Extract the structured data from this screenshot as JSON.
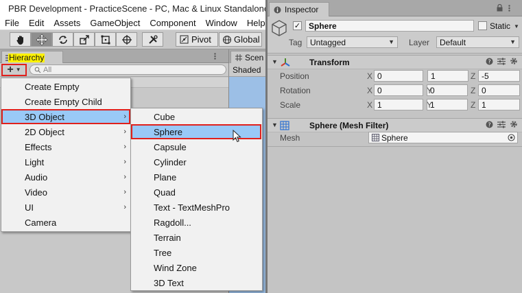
{
  "window": {
    "title": "PBR Development - PracticeScene - PC, Mac & Linux Standalone -"
  },
  "menu_bar": [
    "File",
    "Edit",
    "Assets",
    "GameObject",
    "Component",
    "Window",
    "Help"
  ],
  "toolbar": {
    "pivot_label": "Pivot",
    "global_label": "Global"
  },
  "hierarchy": {
    "tab_label": "Hierarchy",
    "search_placeholder": "All"
  },
  "scene": {
    "tab_label": "Scen",
    "shading_mode": "Shaded"
  },
  "create_menu": {
    "items": [
      {
        "label": "Create Empty",
        "has_submenu": false
      },
      {
        "label": "Create Empty Child",
        "has_submenu": false
      },
      {
        "label": "3D Object",
        "has_submenu": true,
        "highlighted": true
      },
      {
        "label": "2D Object",
        "has_submenu": true
      },
      {
        "label": "Effects",
        "has_submenu": true
      },
      {
        "label": "Light",
        "has_submenu": true
      },
      {
        "label": "Audio",
        "has_submenu": true
      },
      {
        "label": "Video",
        "has_submenu": true
      },
      {
        "label": "UI",
        "has_submenu": true
      },
      {
        "label": "Camera",
        "has_submenu": false
      }
    ]
  },
  "submenu_3d_object": {
    "items": [
      {
        "label": "Cube"
      },
      {
        "label": "Sphere",
        "highlighted": true
      },
      {
        "label": "Capsule"
      },
      {
        "label": "Cylinder"
      },
      {
        "label": "Plane"
      },
      {
        "label": "Quad"
      },
      {
        "label": "Text - TextMeshPro"
      },
      {
        "label": "Ragdoll..."
      },
      {
        "label": "Terrain"
      },
      {
        "label": "Tree"
      },
      {
        "label": "Wind Zone"
      },
      {
        "label": "3D Text"
      }
    ]
  },
  "inspector": {
    "tab_label": "Inspector",
    "object_name": "Sphere",
    "static_label": "Static",
    "tag_label": "Tag",
    "tag_value": "Untagged",
    "layer_label": "Layer",
    "layer_value": "Default",
    "transform": {
      "title": "Transform",
      "position": {
        "label": "Position",
        "x": "0",
        "y": "1",
        "z": "-5"
      },
      "rotation": {
        "label": "Rotation",
        "x": "0",
        "y": "0",
        "z": "0"
      },
      "scale": {
        "label": "Scale",
        "x": "1",
        "y": "1",
        "z": "1"
      }
    },
    "mesh_filter": {
      "title": "Sphere (Mesh Filter)",
      "mesh_label": "Mesh",
      "mesh_value": "Sphere"
    }
  },
  "colors": {
    "highlight": "#99c9f7",
    "annotation_red": "#e0201c",
    "hierarchy_tab_marker": "#fff200"
  }
}
